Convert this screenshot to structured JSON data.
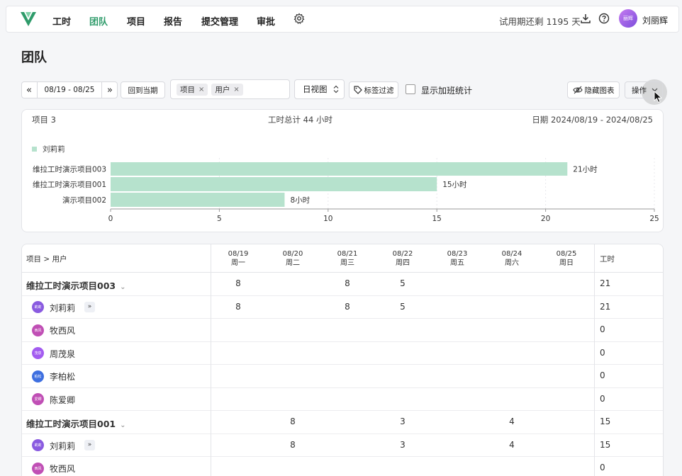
{
  "nav": {
    "items": [
      "工时",
      "团队",
      "项目",
      "报告",
      "提交管理",
      "审批"
    ],
    "active": "团队",
    "trial": "试用期还剩 1195 天",
    "avatar_text": "丽辉",
    "username": "刘丽辉",
    "icons": [
      "logo-icon",
      "gear-icon",
      "download-icon",
      "help-icon"
    ]
  },
  "page": {
    "title": "团队"
  },
  "toolbar": {
    "prev_icon": "«",
    "date_range": "08/19 - 08/25",
    "next_icon": "»",
    "current_period": "回到当期",
    "group_tags": [
      "项目",
      "用户"
    ],
    "tag_remove": "×",
    "view_select": "日视图",
    "tag_filter": "标签过滤",
    "show_overtime": "显示加班统计",
    "hide_chart": "隐藏图表",
    "actions": "操作"
  },
  "summary": {
    "projects": "项目 3",
    "total_hours": "工时总计 44 小时",
    "date_range": "日期 2024/08/19 - 2024/08/25"
  },
  "chart_data": {
    "type": "bar",
    "orientation": "horizontal",
    "categories": [
      "维拉工时演示项目003",
      "维拉工时演示项目001",
      "演示项目002"
    ],
    "series": [
      {
        "name": "刘莉莉",
        "values": [
          21,
          15,
          8
        ]
      }
    ],
    "data_labels": [
      "21小时",
      "15小时",
      "8小时"
    ],
    "xlim": [
      0,
      25
    ],
    "xticks": [
      0,
      5,
      10,
      15,
      20,
      25
    ],
    "grid": true,
    "legend": "top-left",
    "color": "#b6e2cd"
  },
  "table": {
    "header_label": "项目 > 用户",
    "hours_label": "工时",
    "days": [
      {
        "date": "08/19",
        "weekday": "周一"
      },
      {
        "date": "08/20",
        "weekday": "周二"
      },
      {
        "date": "08/21",
        "weekday": "周三"
      },
      {
        "date": "08/22",
        "weekday": "周四"
      },
      {
        "date": "08/23",
        "weekday": "周五"
      },
      {
        "date": "08/24",
        "weekday": "周六"
      },
      {
        "date": "08/25",
        "weekday": "周日"
      }
    ],
    "rows": [
      {
        "type": "project",
        "name": "维拉工时演示项目003",
        "cells": [
          "8",
          "",
          "8",
          "5",
          "",
          "",
          ""
        ],
        "total": "21"
      },
      {
        "type": "user",
        "name": "刘莉莉",
        "avatar": "莉莉",
        "color": "#8a5be0",
        "expand": "»",
        "cells": [
          "8",
          "",
          "8",
          "5",
          "",
          "",
          ""
        ],
        "total": "21"
      },
      {
        "type": "user",
        "name": "牧西风",
        "avatar": "西风",
        "color": "#c04fb5",
        "cells": [
          "",
          "",
          "",
          "",
          "",
          "",
          ""
        ],
        "total": "0"
      },
      {
        "type": "user",
        "name": "周茂泉",
        "avatar": "茂泉",
        "color": "#a35cf0",
        "cells": [
          "",
          "",
          "",
          "",
          "",
          "",
          ""
        ],
        "total": "0"
      },
      {
        "type": "user",
        "name": "李柏松",
        "avatar": "柏松",
        "color": "#3e6fe0",
        "cells": [
          "",
          "",
          "",
          "",
          "",
          "",
          ""
        ],
        "total": "0"
      },
      {
        "type": "user",
        "name": "陈爱卿",
        "avatar": "爱卿",
        "color": "#c04fb5",
        "cells": [
          "",
          "",
          "",
          "",
          "",
          "",
          ""
        ],
        "total": "0"
      },
      {
        "type": "project",
        "name": "维拉工时演示项目001",
        "cells": [
          "",
          "8",
          "",
          "3",
          "",
          "4",
          ""
        ],
        "total": "15"
      },
      {
        "type": "user",
        "name": "刘莉莉",
        "avatar": "莉莉",
        "color": "#8a5be0",
        "expand": "»",
        "cells": [
          "",
          "8",
          "",
          "3",
          "",
          "4",
          ""
        ],
        "total": "15"
      },
      {
        "type": "user",
        "name": "牧西风",
        "avatar": "西风",
        "color": "#c04fb5",
        "cells": [
          "",
          "",
          "",
          "",
          "",
          "",
          ""
        ],
        "total": "0"
      }
    ]
  }
}
